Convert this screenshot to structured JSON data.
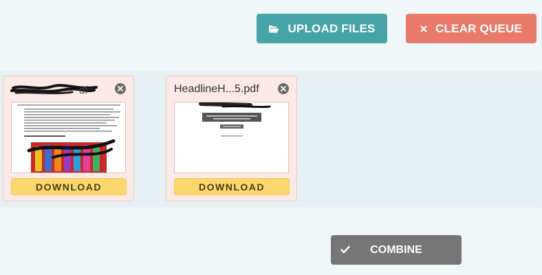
{
  "toolbar": {
    "upload_label": "UPLOAD FILES",
    "upload_icon": "folder-open-icon",
    "clear_label": "CLEAR QUEUE",
    "clear_icon": "close-icon",
    "upload_color": "#46a4a6",
    "clear_color": "#e77a69"
  },
  "queue": {
    "files": [
      {
        "name": "",
        "name_redacted": true,
        "download_label": "DOWNLOAD"
      },
      {
        "name": "HeadlineH...5.pdf",
        "name_redacted": false,
        "download_label": "DOWNLOAD"
      }
    ]
  },
  "combine": {
    "label": "COMBINE",
    "icon": "check-icon",
    "color": "#767676"
  }
}
